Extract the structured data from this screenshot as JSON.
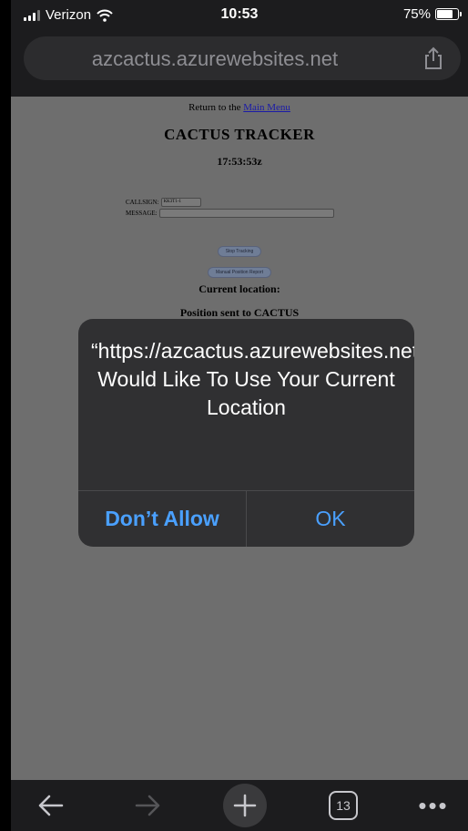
{
  "status_bar": {
    "carrier": "Verizon",
    "time": "10:53",
    "battery": "75%",
    "battery_level": 0.75
  },
  "address_bar": {
    "url": "azcactus.azurewebsites.net"
  },
  "page": {
    "return_prefix": "Return to the ",
    "return_link": "Main Menu",
    "title": "CACTUS TRACKER",
    "time": "17:53:53z",
    "callsign_label": "CALLSIGN:",
    "callsign_value": "KK3T1-1",
    "message_label": "MESSAGE:",
    "message_value": "",
    "stop_button": "Stop Tracking",
    "manual_button": "Manual Position Report",
    "current_location": "Current location:",
    "position_sent": "Position sent to CACTUS"
  },
  "alert": {
    "message": "“https://azcactus.azurewebsites.net” Would Like To Use Your Current Location",
    "deny": "Don’t Allow",
    "ok": "OK"
  },
  "toolbar": {
    "tab_count": "13",
    "more_label": "•••"
  },
  "colors": {
    "chrome": "#1c1c1e",
    "alert_bg": "#303032",
    "accent": "#4aa0ff",
    "page_dim": "#6e6e6e"
  },
  "icons": [
    "wifi-icon",
    "share-icon",
    "back-arrow-icon",
    "forward-arrow-icon",
    "plus-icon",
    "tabs-icon",
    "more-icon"
  ]
}
